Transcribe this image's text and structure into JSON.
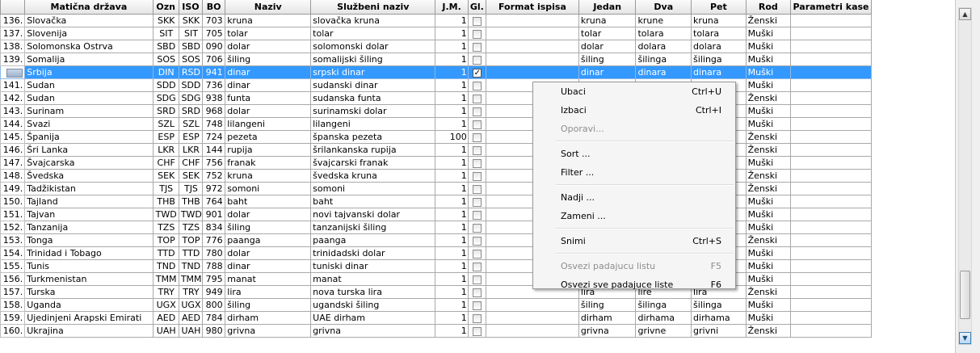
{
  "columns": [
    "Matična država",
    "Ozn",
    "ISO",
    "BO",
    "Naziv",
    "Službeni naziv",
    "J.M.",
    "Gl.",
    "Format ispisa",
    "Jedan",
    "Dva",
    "Pet",
    "Rod",
    "Parametri kase"
  ],
  "rows": [
    {
      "num": "136.",
      "drzava": "Slovačka",
      "ozn": "SKK",
      "iso": "SKK",
      "bo": "703",
      "naziv": "kruna",
      "sluzbeni": "slovačka kruna",
      "jm": "1",
      "gl": "",
      "format": "",
      "jedan": "kruna",
      "dva": "krune",
      "pet": "kruna",
      "rod": "Ženski",
      "param": ""
    },
    {
      "num": "137.",
      "drzava": "Slovenija",
      "ozn": "SIT",
      "iso": "SIT",
      "bo": "705",
      "naziv": "tolar",
      "sluzbeni": "tolar",
      "jm": "1",
      "gl": "",
      "format": "",
      "jedan": "tolar",
      "dva": "tolara",
      "pet": "tolara",
      "rod": "Muški",
      "param": ""
    },
    {
      "num": "138.",
      "drzava": "Solomonska Ostrva",
      "ozn": "SBD",
      "iso": "SBD",
      "bo": "090",
      "naziv": "dolar",
      "sluzbeni": "solomonski dolar",
      "jm": "1",
      "gl": "",
      "format": "",
      "jedan": "dolar",
      "dva": "dolara",
      "pet": "dolara",
      "rod": "Muški",
      "param": ""
    },
    {
      "num": "139.",
      "drzava": "Somalija",
      "ozn": "SOS",
      "iso": "SOS",
      "bo": "706",
      "naziv": "šiling",
      "sluzbeni": "somalijski šiling",
      "jm": "1",
      "gl": "",
      "format": "",
      "jedan": "šiling",
      "dva": "šilinga",
      "pet": "šilinga",
      "rod": "Muški",
      "param": ""
    },
    {
      "num": "",
      "drzava": "Srbija",
      "ozn": "DIN",
      "iso": "RSD",
      "bo": "941",
      "naziv": "dinar",
      "sluzbeni": "srpski dinar",
      "jm": "1",
      "gl": "✓",
      "format": "",
      "jedan": "dinar",
      "dva": "dinara",
      "pet": "dinara",
      "rod": "Muški",
      "param": "",
      "selected": true
    },
    {
      "num": "141.",
      "drzava": "Sudan",
      "ozn": "SDD",
      "iso": "SDD",
      "bo": "736",
      "naziv": "dinar",
      "sluzbeni": "sudanski dinar",
      "jm": "1",
      "gl": "",
      "format": "",
      "jedan": "",
      "dva": "",
      "pet": "",
      "rod": "Muški",
      "param": ""
    },
    {
      "num": "142.",
      "drzava": "Sudan",
      "ozn": "SDG",
      "iso": "SDG",
      "bo": "938",
      "naziv": "funta",
      "sluzbeni": "sudanska funta",
      "jm": "1",
      "gl": "",
      "format": "",
      "jedan": "",
      "dva": "",
      "pet": "",
      "rod": "Ženski",
      "param": ""
    },
    {
      "num": "143.",
      "drzava": "Surinam",
      "ozn": "SRD",
      "iso": "SRD",
      "bo": "968",
      "naziv": "dolar",
      "sluzbeni": "surinamski dolar",
      "jm": "1",
      "gl": "",
      "format": "",
      "jedan": "",
      "dva": "",
      "pet": "",
      "rod": "Muški",
      "param": ""
    },
    {
      "num": "144.",
      "drzava": "Svazi",
      "ozn": "SZL",
      "iso": "SZL",
      "bo": "748",
      "naziv": "lilangeni",
      "sluzbeni": "lilangeni",
      "jm": "1",
      "gl": "",
      "format": "",
      "jedan": "",
      "dva": "",
      "pet": "",
      "rod": "Muški",
      "param": ""
    },
    {
      "num": "145.",
      "drzava": "Španija",
      "ozn": "ESP",
      "iso": "ESP",
      "bo": "724",
      "naziv": "pezeta",
      "sluzbeni": "španska pezeta",
      "jm": "100",
      "gl": "",
      "format": "",
      "jedan": "",
      "dva": "",
      "pet": "",
      "rod": "Ženski",
      "param": ""
    },
    {
      "num": "146.",
      "drzava": "Šri Lanka",
      "ozn": "LKR",
      "iso": "LKR",
      "bo": "144",
      "naziv": "rupija",
      "sluzbeni": "šrilankanska rupija",
      "jm": "1",
      "gl": "",
      "format": "",
      "jedan": "",
      "dva": "",
      "pet": "",
      "rod": "Ženski",
      "param": ""
    },
    {
      "num": "147.",
      "drzava": "Švajcarska",
      "ozn": "CHF",
      "iso": "CHF",
      "bo": "756",
      "naziv": "franak",
      "sluzbeni": "švajcarski franak",
      "jm": "1",
      "gl": "",
      "format": "",
      "jedan": "",
      "dva": "",
      "pet": "",
      "rod": "Muški",
      "param": ""
    },
    {
      "num": "148.",
      "drzava": "Švedska",
      "ozn": "SEK",
      "iso": "SEK",
      "bo": "752",
      "naziv": "kruna",
      "sluzbeni": "švedska kruna",
      "jm": "1",
      "gl": "",
      "format": "",
      "jedan": "",
      "dva": "",
      "pet": "",
      "rod": "Ženski",
      "param": ""
    },
    {
      "num": "149.",
      "drzava": "Tadžikistan",
      "ozn": "TJS",
      "iso": "TJS",
      "bo": "972",
      "naziv": "somoni",
      "sluzbeni": "somoni",
      "jm": "1",
      "gl": "",
      "format": "",
      "jedan": "",
      "dva": "",
      "pet": "",
      "rod": "Ženski",
      "param": ""
    },
    {
      "num": "150.",
      "drzava": "Tajland",
      "ozn": "THB",
      "iso": "THB",
      "bo": "764",
      "naziv": "baht",
      "sluzbeni": "baht",
      "jm": "1",
      "gl": "",
      "format": "",
      "jedan": "",
      "dva": "",
      "pet": "",
      "rod": "Muški",
      "param": ""
    },
    {
      "num": "151.",
      "drzava": "Tajvan",
      "ozn": "TWD",
      "iso": "TWD",
      "bo": "901",
      "naziv": "dolar",
      "sluzbeni": "novi tajvanski dolar",
      "jm": "1",
      "gl": "",
      "format": "",
      "jedan": "",
      "dva": "",
      "pet": "",
      "rod": "Muški",
      "param": ""
    },
    {
      "num": "152.",
      "drzava": "Tanzanija",
      "ozn": "TZS",
      "iso": "TZS",
      "bo": "834",
      "naziv": "šiling",
      "sluzbeni": "tanzanijski šiling",
      "jm": "1",
      "gl": "",
      "format": "",
      "jedan": "",
      "dva": "",
      "pet": "",
      "rod": "Muški",
      "param": ""
    },
    {
      "num": "153.",
      "drzava": "Tonga",
      "ozn": "TOP",
      "iso": "TOP",
      "bo": "776",
      "naziv": "paanga",
      "sluzbeni": "paanga",
      "jm": "1",
      "gl": "",
      "format": "",
      "jedan": "",
      "dva": "",
      "pet": "",
      "rod": "Ženski",
      "param": ""
    },
    {
      "num": "154.",
      "drzava": "Trinidad i Tobago",
      "ozn": "TTD",
      "iso": "TTD",
      "bo": "780",
      "naziv": "dolar",
      "sluzbeni": "trinidadski dolar",
      "jm": "1",
      "gl": "",
      "format": "",
      "jedan": "",
      "dva": "",
      "pet": "",
      "rod": "Muški",
      "param": ""
    },
    {
      "num": "155.",
      "drzava": "Tunis",
      "ozn": "TND",
      "iso": "TND",
      "bo": "788",
      "naziv": "dinar",
      "sluzbeni": "tuniski dinar",
      "jm": "1",
      "gl": "",
      "format": "",
      "jedan": "",
      "dva": "",
      "pet": "",
      "rod": "Muški",
      "param": ""
    },
    {
      "num": "156.",
      "drzava": "Turkmenistan",
      "ozn": "TMM",
      "iso": "TMM",
      "bo": "795",
      "naziv": "manat",
      "sluzbeni": "manat",
      "jm": "1",
      "gl": "",
      "format": "",
      "jedan": "",
      "dva": "",
      "pet": "",
      "rod": "Muški",
      "param": ""
    },
    {
      "num": "157.",
      "drzava": "Turska",
      "ozn": "TRY",
      "iso": "TRY",
      "bo": "949",
      "naziv": "lira",
      "sluzbeni": "nova turska lira",
      "jm": "1",
      "gl": "",
      "format": "",
      "jedan": "lira",
      "dva": "lire",
      "pet": "lira",
      "rod": "Ženski",
      "param": ""
    },
    {
      "num": "158.",
      "drzava": "Uganda",
      "ozn": "UGX",
      "iso": "UGX",
      "bo": "800",
      "naziv": "šiling",
      "sluzbeni": "ugandski šiling",
      "jm": "1",
      "gl": "",
      "format": "",
      "jedan": "šiling",
      "dva": "šilinga",
      "pet": "šilinga",
      "rod": "Muški",
      "param": ""
    },
    {
      "num": "159.",
      "drzava": "Ujedinjeni Arapski Emirati",
      "ozn": "AED",
      "iso": "AED",
      "bo": "784",
      "naziv": "dirham",
      "sluzbeni": "UAE dirham",
      "jm": "1",
      "gl": "",
      "format": "",
      "jedan": "dirham",
      "dva": "dirhama",
      "pet": "dirhama",
      "rod": "Muški",
      "param": ""
    },
    {
      "num": "160.",
      "drzava": "Ukrajina",
      "ozn": "UAH",
      "iso": "UAH",
      "bo": "980",
      "naziv": "grivna",
      "sluzbeni": "grivna",
      "jm": "1",
      "gl": "",
      "format": "",
      "jedan": "grivna",
      "dva": "grivne",
      "pet": "grivni",
      "rod": "Ženski",
      "param": ""
    }
  ],
  "context_menu": {
    "items": [
      {
        "label": "Ubaci",
        "shortcut": "Ctrl+U",
        "disabled": false
      },
      {
        "label": "Izbaci",
        "shortcut": "Ctrl+I",
        "disabled": false
      },
      {
        "label": "Oporavi...",
        "shortcut": "",
        "disabled": true
      },
      {
        "sep": true
      },
      {
        "label": "Sort ...",
        "shortcut": "",
        "disabled": false
      },
      {
        "label": "Filter ...",
        "shortcut": "",
        "disabled": false
      },
      {
        "sep": true
      },
      {
        "label": "Nadji ...",
        "shortcut": "",
        "disabled": false
      },
      {
        "label": "Zameni ...",
        "shortcut": "",
        "disabled": false
      },
      {
        "sep": true
      },
      {
        "label": "Snimi",
        "shortcut": "Ctrl+S",
        "disabled": false
      },
      {
        "sep": true
      },
      {
        "label": "Osvezi padajucu listu",
        "shortcut": "F5",
        "disabled": true
      },
      {
        "label": "Osvezi sve padajuce liste",
        "shortcut": "F6",
        "disabled": false
      }
    ]
  },
  "colors": {
    "selection": "#3399ff",
    "menu_bg": "#f5f5f5",
    "disabled_text": "#8d8d8d"
  },
  "icons": {
    "row_selector": "row-selector-icon",
    "scroll_up": "scroll-up-icon",
    "scroll_down": "scroll-down-icon"
  }
}
